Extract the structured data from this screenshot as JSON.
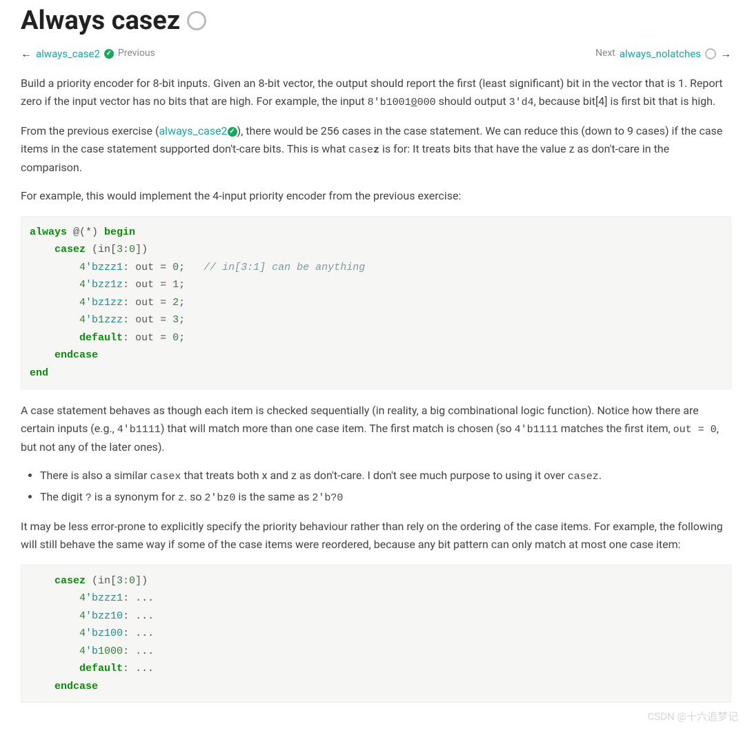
{
  "title": "Always casez",
  "nav": {
    "prev_link": "always_case2",
    "prev_label": "Previous",
    "next_label": "Next",
    "next_link": "always_nolatches"
  },
  "para1": {
    "pre": "Build a priority encoder for 8-bit inputs. Given an 8-bit vector, the output should report the first (least significant) bit in the vector that is 1. Report zero if the input vector has no bits that are high. For example, the input ",
    "code1": "8'b1001",
    "u1": "0",
    "code1b": "000",
    "mid": " should output ",
    "code2": "3'd4",
    "post": ", because bit[4] is first bit that is high."
  },
  "para2": {
    "pre": "From the previous exercise (",
    "link": "always_case2",
    "post_link": "), there would be 256 cases in the case statement. We can reduce this (down to 9 cases) if the case items in the case statement supported don't-care bits. This is what ",
    "code_case": "case",
    "bold_z": "z",
    "tail": " is for: It treats bits that have the value z as don't-care in the comparison."
  },
  "para3": "For example, this would implement the 4-input priority encoder from the previous exercise:",
  "code1": {
    "kw_always": "always",
    "at": " @(*) ",
    "kw_begin": "begin",
    "kw_casez": "casez",
    "in_expr": " (in[",
    "in_slice": "3:0",
    "in_close": "])",
    "lit_prefix": "4",
    "lit_b": "'b",
    "l1": "zzz1",
    "v1": "0",
    "comment": "// in[3:1] can be anything",
    "l2": "zz1z",
    "v2": "1",
    "l3": "z1zz",
    "v3": "2",
    "l4": "1zzz",
    "v4": "3",
    "kw_default": "default",
    "vd": "0",
    "kw_endcase": "endcase",
    "kw_end": "end",
    "out": "out",
    "eq": " = ",
    "semi": ";"
  },
  "para4": {
    "pre": "A case statement behaves as though each item is checked sequentially (in reality, a big combinational logic function). Notice how there are certain inputs (e.g., ",
    "c1": "4'b1111",
    "mid1": ") that will match more than one case item. The first match is chosen (so ",
    "c2": "4'b1111",
    "mid2": " matches the first item, ",
    "c3": "out = 0",
    "post": ", but not any of the later ones)."
  },
  "bullets": {
    "b1_pre": "There is also a similar ",
    "b1_casex": "casex",
    "b1_mid": " that treats both x and z as don't-care. I don't see much purpose to using it over ",
    "b1_casez": "casez",
    "b1_post": ".",
    "b2_pre": "The digit ",
    "b2_q": "?",
    "b2_mid": " is a synonym for ",
    "b2_z": "z",
    "b2_mid2": ". so ",
    "b2_a": "2'bz0",
    "b2_mid3": " is the same as ",
    "b2_b": "2'b?0"
  },
  "para5": "It may be less error-prone to explicitly specify the priority behaviour rather than rely on the ordering of the case items. For example, the following will still behave the same way if some of the case items were reordered, because any bit pattern can only match at most one case item:",
  "code2": {
    "kw_casez": "casez",
    "in_expr": " (in[",
    "in_slice": "3:0",
    "in_close": "])",
    "lit_prefix": "4",
    "lit_b": "'b",
    "l1": "zzz1",
    "l2": "zz10",
    "l3": "z100",
    "l4": "1000",
    "kw_default": "default",
    "dots": ": ...",
    "kw_endcase": "endcase"
  },
  "watermark": "CSDN @十六追梦记"
}
